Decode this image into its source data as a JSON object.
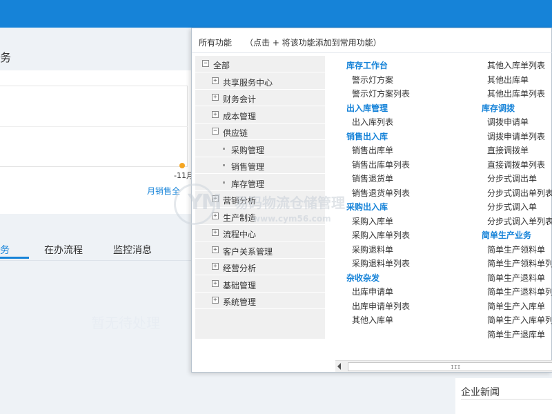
{
  "background": {
    "title": "务",
    "chart": {
      "tick_label": "-11月",
      "legend_label": "月销售全"
    },
    "tabs": [
      {
        "label": "任务",
        "active": true
      },
      {
        "label": "在办流程",
        "active": false
      },
      {
        "label": "监控消息",
        "active": false
      }
    ],
    "empty_hint": "暂无待处理",
    "news_title": "企业新闻"
  },
  "popup": {
    "title": "所有功能",
    "hint": "（点击 + 将该功能添加到常用功能）",
    "tree": [
      {
        "label": "全部",
        "toggle": "−"
      },
      {
        "label": "共享服务中心",
        "toggle": "+"
      },
      {
        "label": "财务会计",
        "toggle": "+"
      },
      {
        "label": "成本管理",
        "toggle": "+"
      },
      {
        "label": "供应链",
        "toggle": "−"
      },
      {
        "label": "采购管理",
        "toggle": ""
      },
      {
        "label": "销售管理",
        "toggle": ""
      },
      {
        "label": "库存管理",
        "toggle": ""
      },
      {
        "label": "营销分析",
        "toggle": "+"
      },
      {
        "label": "生产制造",
        "toggle": "+"
      },
      {
        "label": "流程中心",
        "toggle": "+"
      },
      {
        "label": "客户关系管理",
        "toggle": "+"
      },
      {
        "label": "经营分析",
        "toggle": "+"
      },
      {
        "label": "基础管理",
        "toggle": "+"
      },
      {
        "label": "系统管理",
        "toggle": "+"
      }
    ],
    "col1": [
      {
        "title": "库存工作台",
        "items": [
          "警示灯方案",
          "警示灯方案列表"
        ]
      },
      {
        "title": "出入库管理",
        "items": [
          "出入库列表"
        ]
      },
      {
        "title": "销售出入库",
        "items": [
          "销售出库单",
          "销售出库单列表",
          "销售退货单",
          "销售退货单列表"
        ]
      },
      {
        "title": "采购出入库",
        "items": [
          "采购入库单",
          "采购入库单列表",
          "采购退料单",
          "采购退料单列表"
        ]
      },
      {
        "title": "杂收杂发",
        "items": [
          "出库申请单",
          "出库申请单列表",
          "其他入库单"
        ]
      }
    ],
    "col2": [
      {
        "title": "",
        "items": [
          "其他入库单列表",
          "其他出库单",
          "其他出库单列表"
        ]
      },
      {
        "title": "库存调拨",
        "items": [
          "调拨申请单",
          "调拨申请单列表",
          "直接调拨单",
          "直接调拨单列表",
          "分步式调出单",
          "分步式调出单列表",
          "分步式调入单",
          "分步式调入单列表"
        ]
      },
      {
        "title": "简单生产业务",
        "items": [
          "简单生产领料单",
          "简单生产领料单列",
          "简单生产退料单",
          "简单生产退料单列",
          "简单生产入库单",
          "简单生产入库单列",
          "简单生产退库单"
        ]
      }
    ],
    "scrollbar_grip": "III"
  },
  "watermark": {
    "letters": "YM",
    "text": "易码物流仓储管理",
    "url": "www.cym56.com"
  }
}
